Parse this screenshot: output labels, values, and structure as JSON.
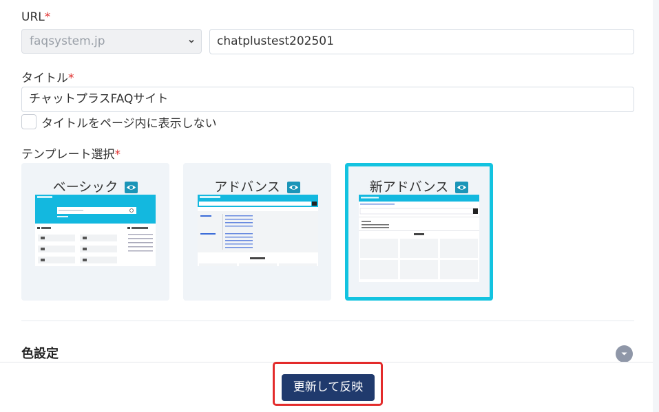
{
  "url_section": {
    "label": "URL",
    "required_mark": "*",
    "domain_select_value": "faqsystem.jp",
    "subdomain_value": "chatplustest202501"
  },
  "title_section": {
    "label": "タイトル",
    "required_mark": "*",
    "title_value": "チャットプラスFAQサイト",
    "hide_title_checkbox_label": "タイトルをページ内に表示しない",
    "hide_title_checked": false
  },
  "template_section": {
    "label": "テンプレート選択",
    "required_mark": "*",
    "templates": [
      {
        "name": "ベーシック",
        "selected": false,
        "preview_icon": "eye-icon"
      },
      {
        "name": "アドバンス",
        "selected": false,
        "preview_icon": "eye-icon"
      },
      {
        "name": "新アドバンス",
        "selected": true,
        "preview_icon": "eye-icon"
      }
    ]
  },
  "color_section": {
    "title": "色設定",
    "toggle_icon": "chevron-down-icon"
  },
  "footer": {
    "update_button_label": "更新して反映"
  },
  "colors": {
    "accent_cyan": "#13c3e0",
    "button_navy": "#203a6d",
    "highlight_red": "#e32b2b",
    "required_red": "#e0312f",
    "eye_icon_teal": "#1b95b8"
  }
}
